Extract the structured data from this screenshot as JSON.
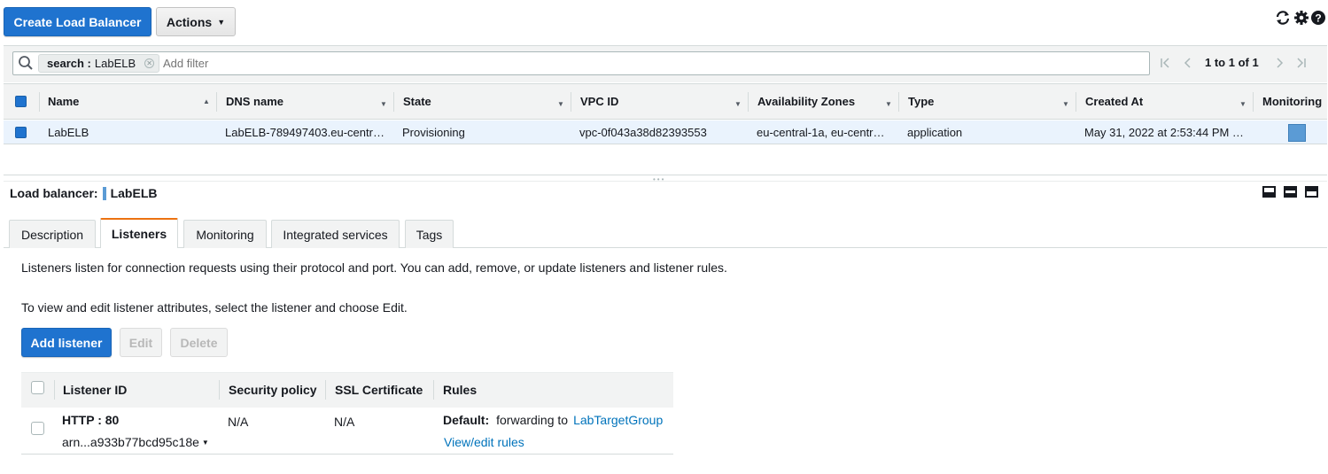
{
  "toolbar": {
    "create_label": "Create Load Balancer",
    "actions_label": "Actions",
    "refresh_icon": "refresh-icon",
    "settings_icon": "gear-icon",
    "help_icon": "help-icon"
  },
  "filter": {
    "chip_key": "search :",
    "chip_value": "LabELB",
    "placeholder": "Add filter",
    "pagination": "1 to 1 of 1"
  },
  "table": {
    "columns": [
      "Name",
      "DNS name",
      "State",
      "VPC ID",
      "Availability Zones",
      "Type",
      "Created At",
      "Monitoring"
    ],
    "rows": [
      {
        "name": "LabELB",
        "dns": "LabELB-789497403.eu-centr…",
        "state": "Provisioning",
        "vpc": "vpc-0f043a38d82393553",
        "az": "eu-central-1a, eu-centr…",
        "type": "application",
        "created": "May 31, 2022 at 2:53:44 PM …"
      }
    ]
  },
  "details": {
    "title_prefix": "Load balancer:",
    "title_value": "LabELB",
    "tabs": [
      "Description",
      "Listeners",
      "Monitoring",
      "Integrated services",
      "Tags"
    ],
    "active_tab": "Listeners",
    "intro": "Listeners listen for connection requests using their protocol and port. You can add, remove, or update listeners and listener rules.",
    "edit_hint": "To view and edit listener attributes, select the listener and choose Edit.",
    "add_label": "Add listener",
    "edit_label": "Edit",
    "delete_label": "Delete"
  },
  "listeners": {
    "columns": [
      "Listener ID",
      "Security policy",
      "SSL Certificate",
      "Rules"
    ],
    "rows": [
      {
        "id": "HTTP : 80",
        "arn": "arn...a933b77bcd95c18e",
        "security_policy": "N/A",
        "ssl": "N/A",
        "rule_default": "Default:",
        "rule_action": "forwarding to",
        "rule_target": "LabTargetGroup",
        "view_rules": "View/edit rules"
      }
    ]
  },
  "colors": {
    "primary": "#1f73cf",
    "selected_row": "#eaf3fd",
    "tab_accent": "#ec7211",
    "link": "#0073bb"
  }
}
